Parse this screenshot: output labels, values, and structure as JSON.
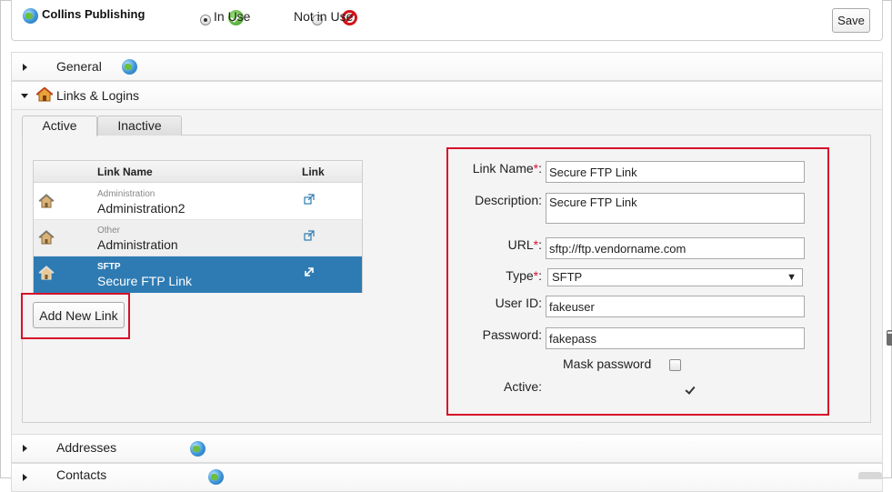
{
  "header": {
    "company_name": "Collins Publishing",
    "status_options": [
      {
        "label": "In Use",
        "selected": true
      },
      {
        "label": "Not in Use",
        "selected": false
      }
    ],
    "save_label": "Save"
  },
  "sections": [
    {
      "label": "General",
      "icon": "globe-icon",
      "expanded": false
    },
    {
      "label": "Links & Logins",
      "icon": "house-icon",
      "expanded": true
    },
    {
      "label": "Addresses",
      "icon": "globe-house-icon",
      "expanded": false
    },
    {
      "label": "Contacts",
      "icon": "globe-icon",
      "expanded": false
    }
  ],
  "tabs": [
    {
      "label": "Active",
      "active": true
    },
    {
      "label": "Inactive",
      "active": false
    }
  ],
  "links_table": {
    "columns": [
      "",
      "Link Name",
      "Link"
    ],
    "rows": [
      {
        "category": "Administration",
        "name": "Administration2",
        "selected": false
      },
      {
        "category": "Other",
        "name": "Administration",
        "selected": false
      },
      {
        "category": "SFTP",
        "name": "Secure FTP Link",
        "selected": true
      }
    ]
  },
  "add_link_label": "Add New Link",
  "form": {
    "link_name_label": "Link Name",
    "link_name_value": "Secure FTP Link",
    "description_label": "Description:",
    "description_value": "Secure FTP Link",
    "url_label": "URL",
    "url_value": "sftp://ftp.vendorname.com",
    "type_label": "Type",
    "type_value": "SFTP",
    "user_id_label": "User ID:",
    "user_id_value": "fakeuser",
    "password_label": "Password:",
    "password_value": "fakepass",
    "mask_password_label": "Mask password",
    "mask_password_checked": false,
    "active_label": "Active:",
    "active_checked": true,
    "required_mark": "*",
    "label_suffix": ":"
  },
  "colors": {
    "selection_blue": "#2e7bb3",
    "highlight_red": "#d6112a"
  }
}
